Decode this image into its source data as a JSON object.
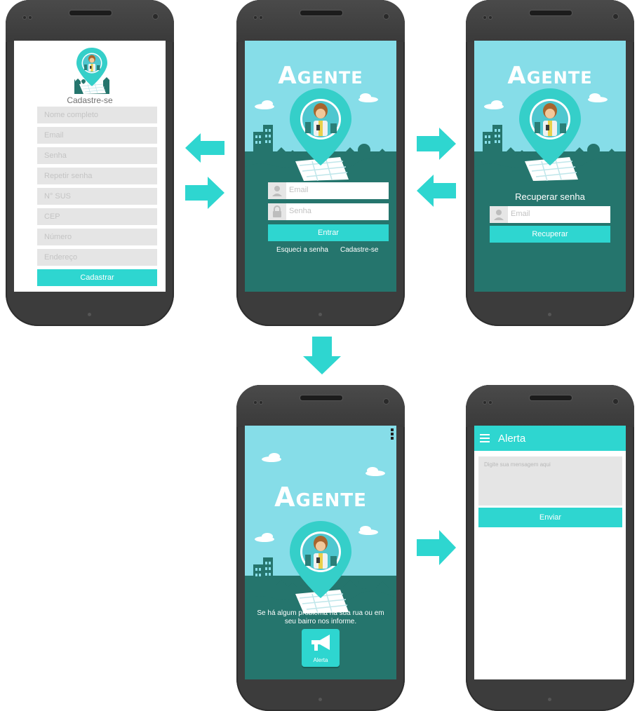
{
  "brand": {
    "title_first": "A",
    "title_rest": "GENTE"
  },
  "register": {
    "heading": "Cadastre-se",
    "fields": [
      "Nome completo",
      "Email",
      "Senha",
      "Repetir senha",
      "N° SUS",
      "CEP",
      "Número",
      "Endereço"
    ],
    "submit": "Cadastrar"
  },
  "login": {
    "email_placeholder": "Email",
    "password_placeholder": "Senha",
    "submit": "Entrar",
    "forgot_link": "Esqueci a senha",
    "register_link": "Cadastre-se"
  },
  "recover": {
    "heading": "Recuperar senha",
    "email_placeholder": "Email",
    "submit": "Recuperar"
  },
  "home": {
    "message": "Se há algum problema na sua rua ou em seu bairro nos informe.",
    "alert_button": "Alerta"
  },
  "alert": {
    "title": "Alerta",
    "message_placeholder": "Digite sua mensagem aqui",
    "send": "Enviar"
  },
  "colors": {
    "accent": "#2ed6d0",
    "sky": "#86dde8",
    "ground": "#25756d",
    "pin": "#35cfc9",
    "frame": "#3c3c3c"
  }
}
